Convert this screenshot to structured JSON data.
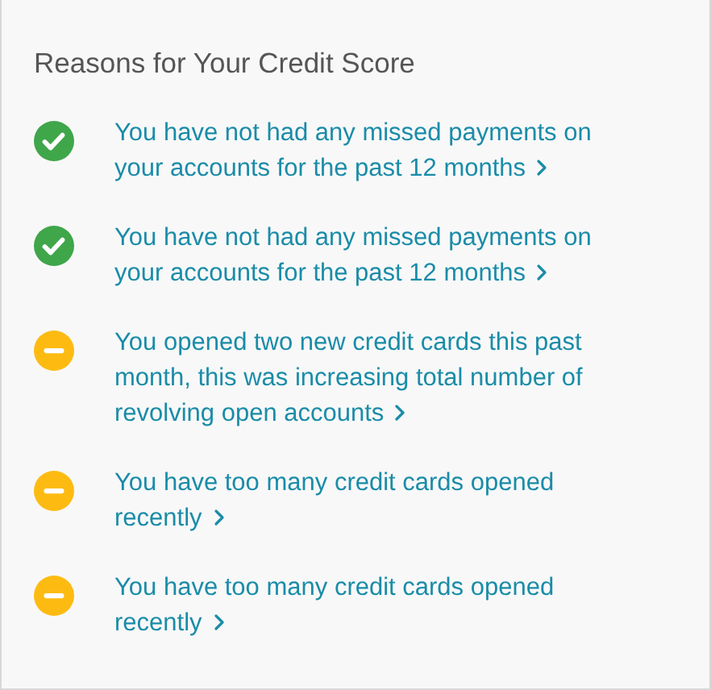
{
  "title": "Reasons for Your Credit Score",
  "reasons": [
    {
      "kind": "positive",
      "text": "You have not had any missed payments on your accounts for the past 12 months"
    },
    {
      "kind": "positive",
      "text": "You have not had any missed payments on your accounts for the past 12 months"
    },
    {
      "kind": "caution",
      "text": "You opened two new credit cards this past month, this was increasing total number of revolving open accounts"
    },
    {
      "kind": "caution",
      "text": "You have too many credit cards opened recently"
    },
    {
      "kind": "caution",
      "text": "You have too many credit cards opened recently"
    }
  ]
}
